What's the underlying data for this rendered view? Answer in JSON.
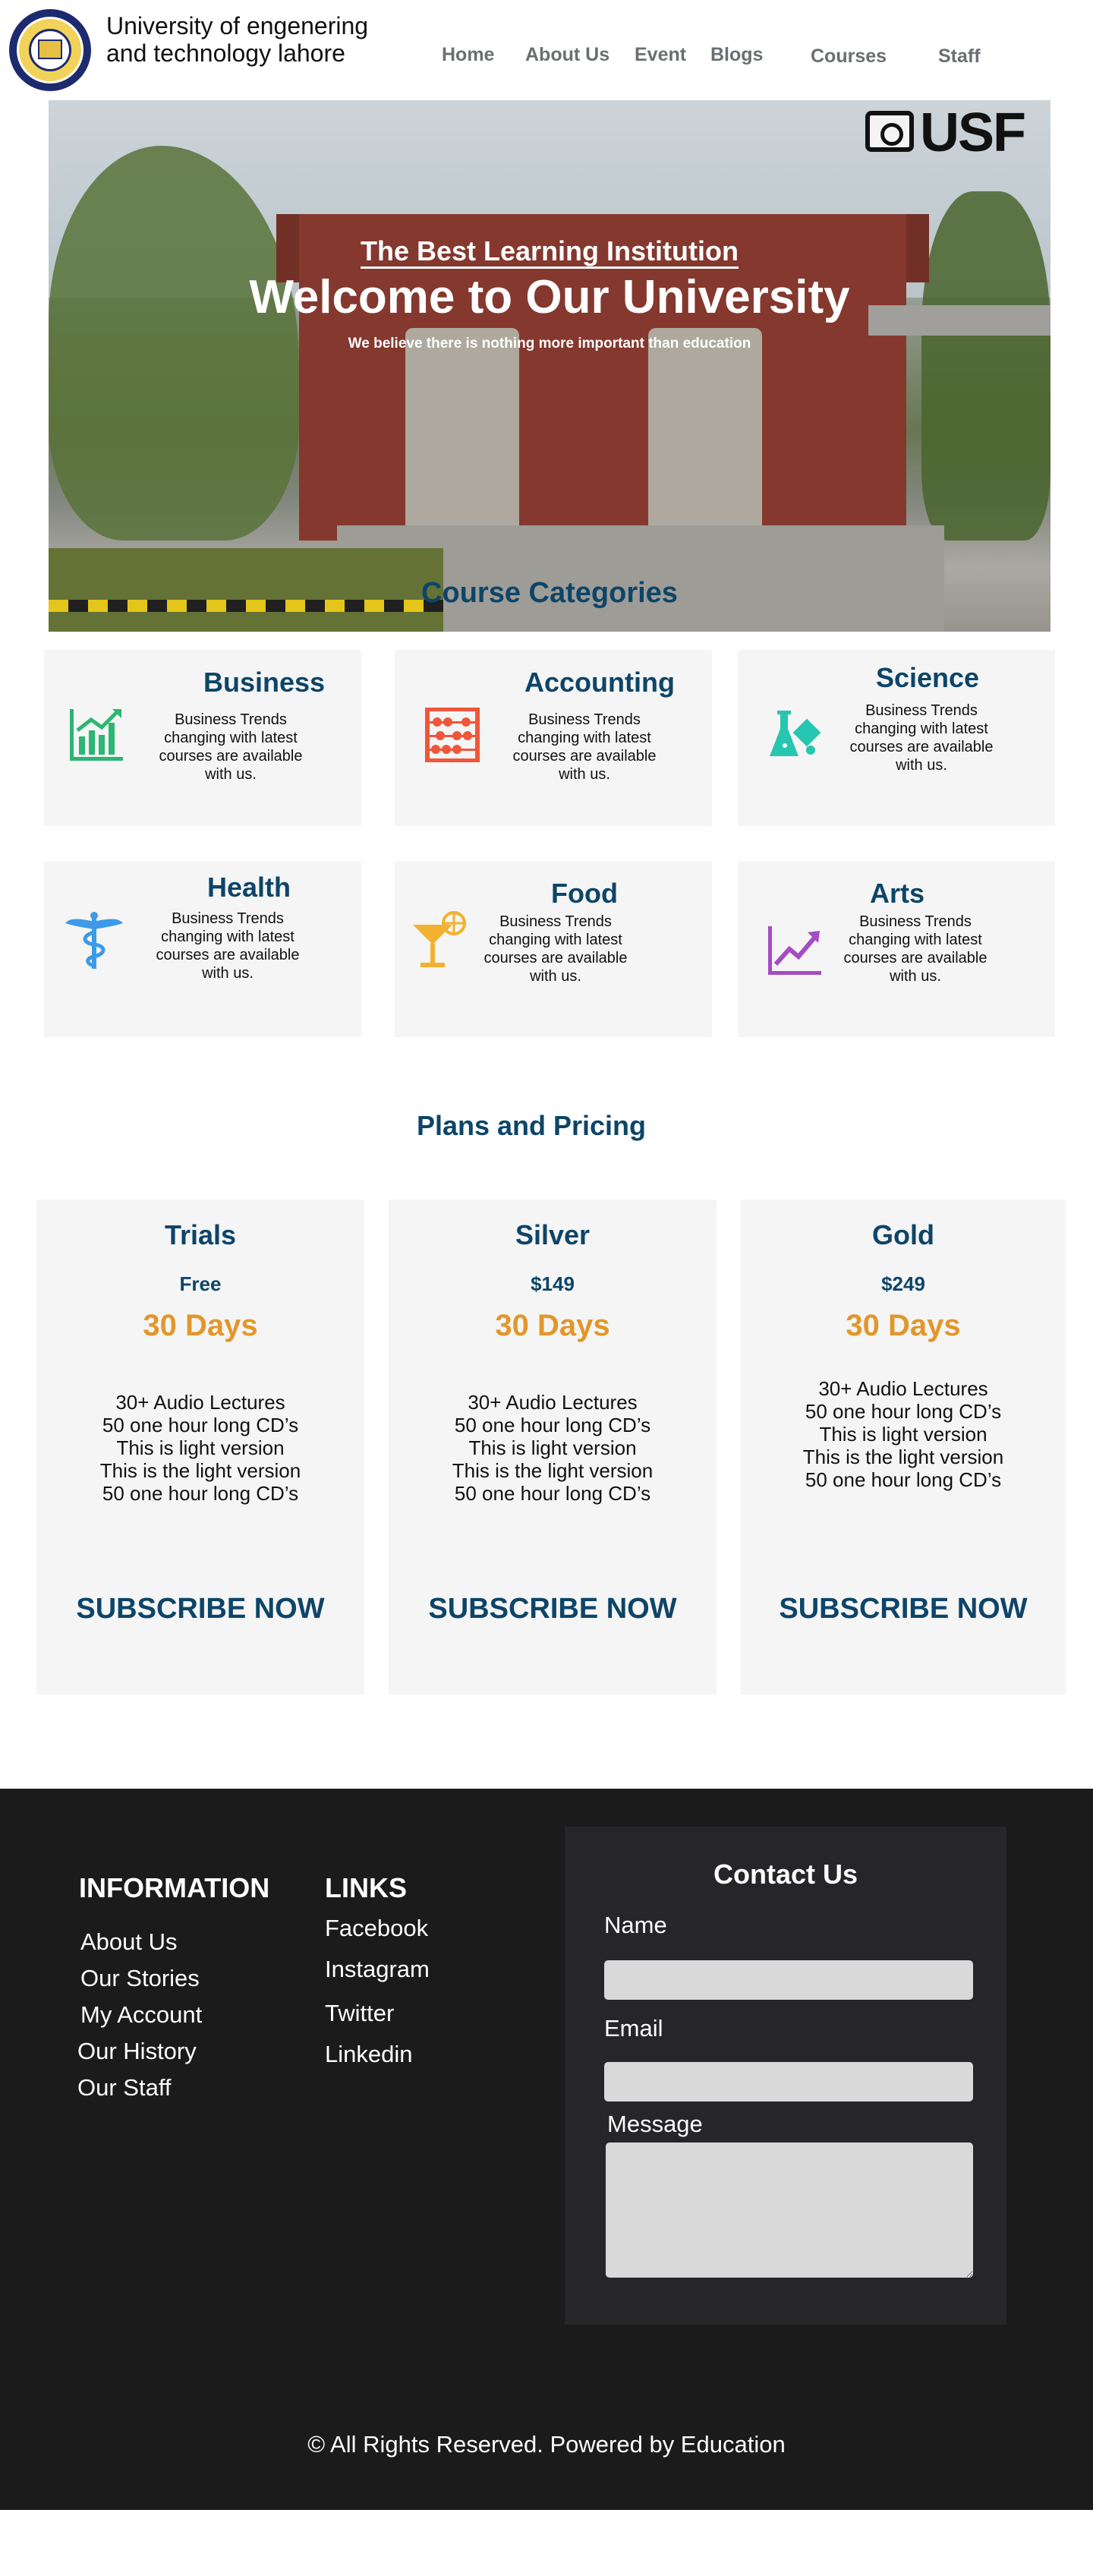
{
  "header": {
    "title": "University of engenering and technology lahore",
    "nav": [
      "Home",
      "About Us",
      "Event",
      "Blogs",
      "Courses",
      "Staff"
    ],
    "logo_icon": "university-crest-icon"
  },
  "hero": {
    "watermark": "USF",
    "subtitle": "The Best Learning Institution",
    "title": "Welcome to Our University",
    "tagline": "We believe there is nothing more important than education",
    "categories_heading": "Course Categories"
  },
  "categories": [
    {
      "title": "Business",
      "desc": "Business Trends changing with latest courses are available with us.",
      "icon": "bar-chart-growth-icon",
      "color": "#2bb673"
    },
    {
      "title": "Accounting",
      "desc": "Business Trends changing with latest courses are available with us.",
      "icon": "abacus-icon",
      "color": "#f0563a"
    },
    {
      "title": "Science",
      "desc": "Business Trends changing with latest courses are available with us.",
      "icon": "flask-icon",
      "color": "#26c6b0"
    },
    {
      "title": "Health",
      "desc": "Business Trends changing with latest courses are available with us.",
      "icon": "caduceus-icon",
      "color": "#3d9ae8"
    },
    {
      "title": "Food",
      "desc": "Business Trends changing with latest courses are available with us.",
      "icon": "cocktail-icon",
      "color": "#f2b12f"
    },
    {
      "title": "Arts",
      "desc": "Business Trends changing with latest courses are available with us.",
      "icon": "trend-line-icon",
      "color": "#a54cc4"
    }
  ],
  "pricing": {
    "heading": "Plans and Pricing",
    "plans": [
      {
        "name": "Trials",
        "price": "Free",
        "days": "30 Days",
        "features": [
          "30+ Audio Lectures",
          "50 one hour long CD’s",
          "This is light version",
          "This is the light version",
          "50 one hour long CD’s"
        ],
        "cta": "SUBSCRIBE NOW"
      },
      {
        "name": "Silver",
        "price": "$149",
        "days": "30 Days",
        "features": [
          "30+ Audio Lectures",
          "50 one hour long CD’s",
          "This is light version",
          "This is the light version",
          "50 one hour long CD’s"
        ],
        "cta": "SUBSCRIBE NOW"
      },
      {
        "name": "Gold",
        "price": "$249",
        "days": "30 Days",
        "features": [
          "30+ Audio Lectures",
          "50 one hour long CD’s",
          "This is light version",
          "This is the light version",
          "50 one hour long CD’s"
        ],
        "cta": "SUBSCRIBE NOW"
      }
    ]
  },
  "footer": {
    "information": {
      "heading": "INFORMATION",
      "links": [
        "About Us",
        "Our Stories",
        "My Account",
        "Our History",
        "Our Staff"
      ]
    },
    "links": {
      "heading": "LINKS",
      "items": [
        "Facebook",
        "Instagram",
        "Twitter",
        "Linkedin"
      ]
    },
    "contact": {
      "title": "Contact Us",
      "name_label": "Name",
      "email_label": "Email",
      "message_label": "Message"
    },
    "copyright": "© All Rights Reserved. Powered by Education"
  }
}
